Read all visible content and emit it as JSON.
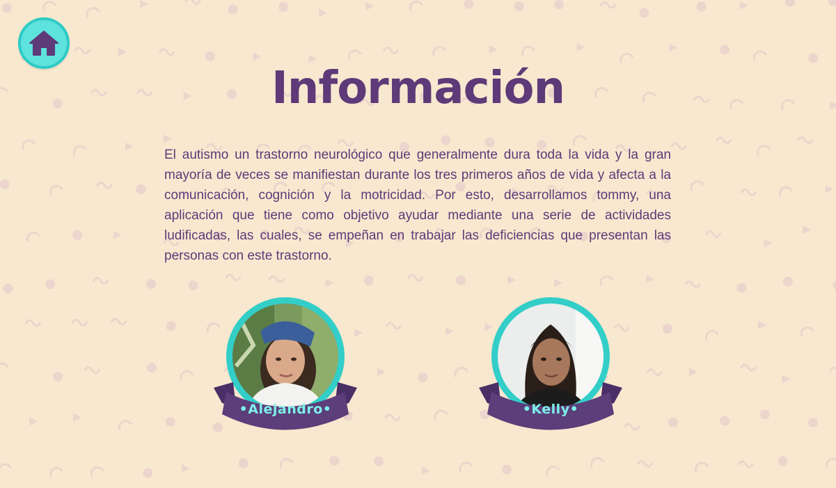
{
  "page": {
    "title": "Información",
    "description": "El autismo un trastorno neurológico que generalmente dura toda la vida y la gran mayoría de veces se manifiestan durante los tres primeros años de vida y afecta a la comunicación, cognición y la motricidad. Por esto, desarrollamos tommy, una aplicación que tiene como objetivo ayudar mediante una serie de actividades ludificadas, las cuales, se empeñan en trabajar las deficiencias que presentan las personas con este trastorno."
  },
  "home_button": {
    "icon": "home-icon"
  },
  "team": [
    {
      "name": "•Alejandro•"
    },
    {
      "name": "•Kelly•"
    }
  ],
  "colors": {
    "background": "#f8e8cf",
    "primary_purple": "#5e3a78",
    "accent_cyan": "#33cec8",
    "ribbon_purple": "#5c3e7a",
    "pattern": "#ecd5cc"
  }
}
